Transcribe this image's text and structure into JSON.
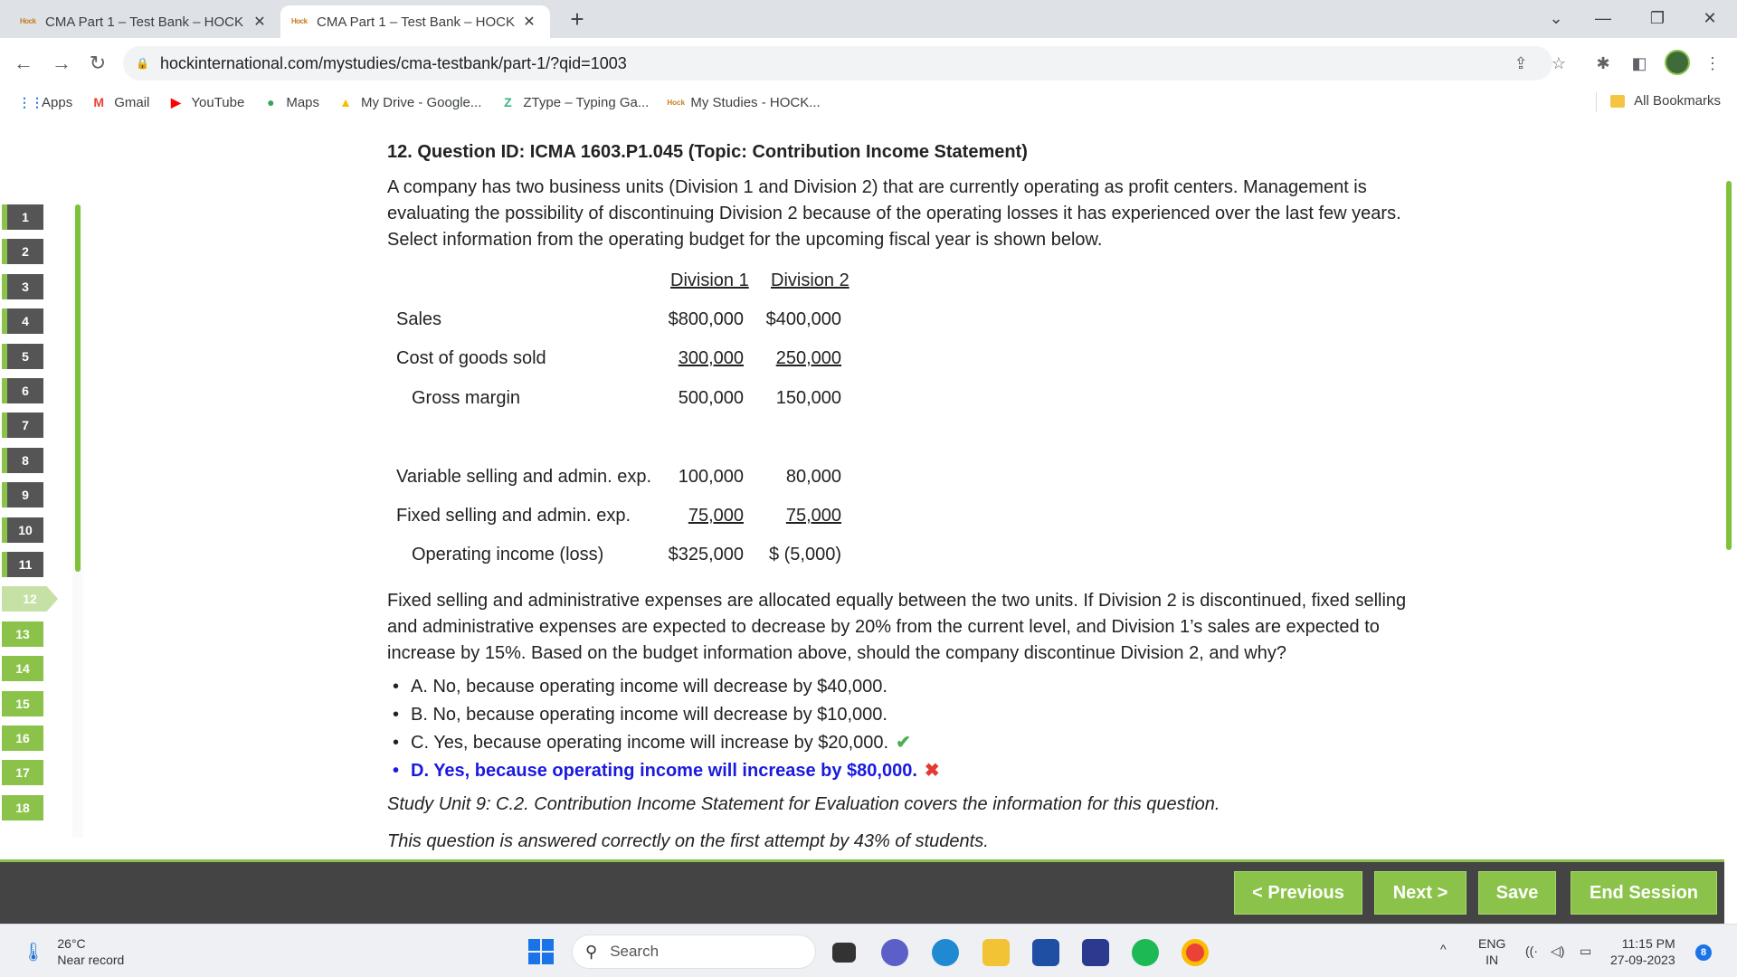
{
  "browser": {
    "tabs": [
      {
        "favicon": "Hock",
        "title": "CMA Part 1 – Test Bank – HOCK",
        "active": false
      },
      {
        "favicon": "Hock",
        "title": "CMA Part 1 – Test Bank – HOCK",
        "active": true
      }
    ],
    "url": "hockinternational.com/mystudies/cma-testbank/part-1/?qid=1003",
    "bookmarks": [
      {
        "icon": "apps-grid-icon",
        "label": "Apps"
      },
      {
        "icon": "gmail-icon",
        "label": "Gmail"
      },
      {
        "icon": "youtube-icon",
        "label": "YouTube"
      },
      {
        "icon": "maps-icon",
        "label": "Maps"
      },
      {
        "icon": "google-drive-icon",
        "label": "My Drive - Google..."
      },
      {
        "icon": "ztype-icon",
        "label": "ZType – Typing Ga..."
      },
      {
        "icon": "hock-icon",
        "label": "My Studies - HOCK..."
      }
    ],
    "all_bookmarks_label": "All Bookmarks"
  },
  "question_nav": {
    "numbers": [
      "1",
      "2",
      "3",
      "4",
      "5",
      "6",
      "7",
      "8",
      "9",
      "10",
      "11",
      "12",
      "13",
      "14",
      "15",
      "16",
      "17",
      "18"
    ],
    "current": "12"
  },
  "question": {
    "heading": "12. Question ID: ICMA 1603.P1.045 (Topic: Contribution Income Statement)",
    "intro": "A company has two business units (Division 1 and Division 2) that are currently operating as profit centers. Management is evaluating the possibility of discontinuing Division 2 because of the operating losses it has experienced over the last few years. Select information from the operating budget for the upcoming fiscal year is shown below.",
    "budget": {
      "col1": "Division 1",
      "col2": "Division 2",
      "rows": {
        "sales": {
          "label": "Sales",
          "d1": "$800,000",
          "d2": "$400,000"
        },
        "cogs": {
          "label": "Cost of goods sold",
          "d1": "300,000",
          "d2": "250,000"
        },
        "gross": {
          "label": "Gross margin",
          "d1": "500,000",
          "d2": "150,000"
        },
        "var_exp": {
          "label": "Variable selling and admin. exp.",
          "d1": "100,000",
          "d2": "80,000"
        },
        "fix_exp": {
          "label": "Fixed selling and admin. exp.",
          "d1": "75,000",
          "d2": "75,000"
        },
        "op_income": {
          "label": "Operating income (loss)",
          "d1": "$325,000",
          "d2": "$ (5,000)"
        }
      }
    },
    "after": "Fixed selling and administrative expenses are allocated equally between the two units. If Division 2 is discontinued, fixed selling and administrative expenses are expected to decrease by 20% from the current level, and Division 1’s sales are expected to increase by 15%. Based on the budget information above, should the company discontinue Division 2, and why?",
    "options": {
      "a": "A. No, because operating income will decrease by $40,000.",
      "b": "B. No, because operating income will decrease by $10,000.",
      "c": "C. Yes, because operating income will increase by $20,000.",
      "d": "D. Yes, because operating income will increase by $80,000."
    },
    "correct_option": "C",
    "selected_option": "D",
    "study_note": "Study Unit 9: C.2. Contribution Income Statement for Evaluation covers the information for this question.",
    "stats_note": "This question is answered correctly on the first attempt by 43% of students."
  },
  "actions": {
    "previous": "< Previous",
    "next": "Next >",
    "save": "Save",
    "end": "End Session"
  },
  "taskbar": {
    "temp": "26°C",
    "weather": "Near record",
    "search": "Search",
    "lang1": "ENG",
    "lang2": "IN",
    "time": "11:15 PM",
    "date": "27-09-2023",
    "notifications": "8"
  },
  "colors": {
    "accent": "#8bc34a",
    "selected_answer": "#1a1adf",
    "action_bar": "#444444"
  }
}
